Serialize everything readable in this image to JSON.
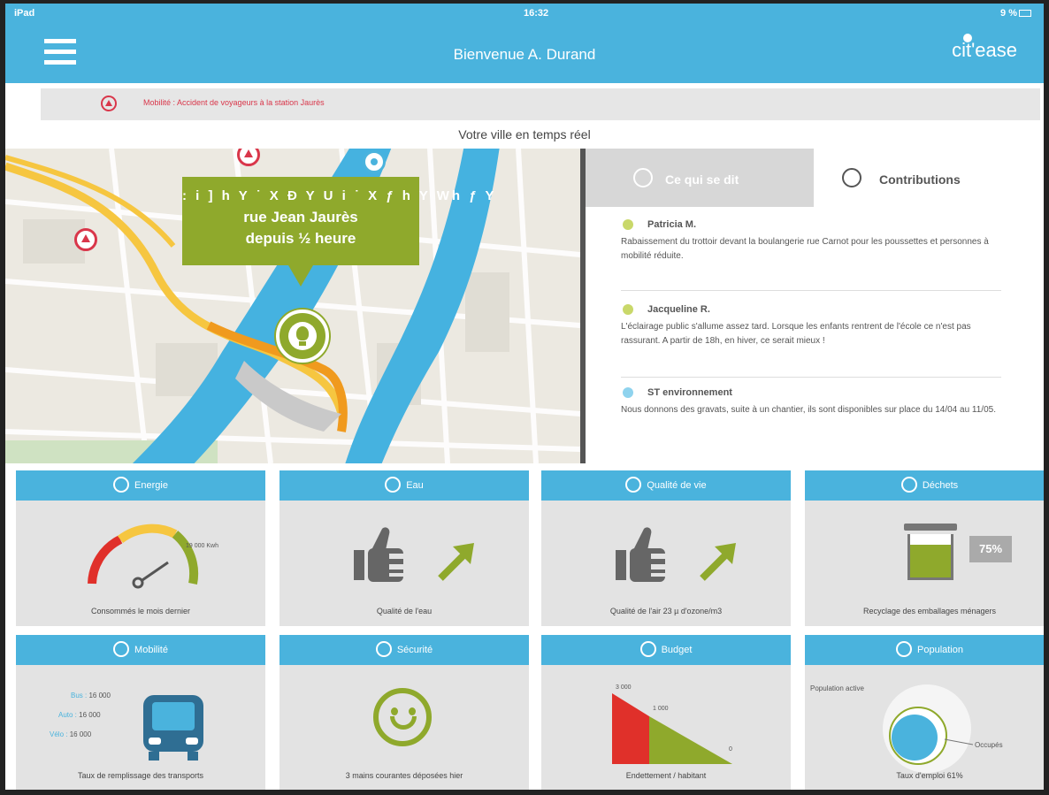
{
  "status_bar": {
    "carrier": "iPad",
    "time": "16:32",
    "battery": "9 %"
  },
  "header": {
    "title": "Bienvenue A. Durand",
    "logo": "cit'ease",
    "accent": "#4ab3dd"
  },
  "alert": {
    "text": "Mobilité : Accident de voyageurs à la station Jaurès",
    "color": "#d9364a"
  },
  "section_title": "Votre ville en temps réel",
  "map": {
    "tooltip": {
      "line1": ": i ] h Y ˙ X Ð Y U i ˙ X ƒ h Y Wh ƒ Y",
      "line2": "rue Jean Jaurès",
      "line3": "depuis ½ heure"
    },
    "pin_icon": "lightbulb-icon",
    "highlight": "#8fa92c"
  },
  "panel": {
    "tabs": [
      {
        "label": "Ce qui se dit",
        "icon": "twitter-icon"
      },
      {
        "label": "Contributions",
        "icon": "smiley-icon"
      }
    ],
    "contributions": [
      {
        "name": "Patricia M.",
        "text": "Rabaissement du trottoir devant la boulangerie rue Carnot pour les poussettes et personnes à mobilité réduite."
      },
      {
        "name": "Jacqueline R.",
        "text": "L'éclairage public s'allume assez tard. Lorsque les enfants rentrent de l'école ce n'est pas rassurant. A partir de 18h, en hiver, ce serait mieux !"
      },
      {
        "name": "ST environnement",
        "text": "Nous donnons des gravats, suite à un chantier, ils sont disponibles sur place du 14/04 au 11/05."
      }
    ]
  },
  "tiles": {
    "energie": {
      "title": "Energie",
      "icon": "energy-icon",
      "gauge_label": "19 000 Kwh",
      "footer": "Consommés le mois dernier"
    },
    "eau": {
      "title": "Eau",
      "icon": "water-icon",
      "footer": "Qualité de l'eau"
    },
    "qualite": {
      "title": "Qualité de vie",
      "icon": "leaf-icon",
      "footer": "Qualité de l'air 23 µ d'ozone/m3"
    },
    "dechets": {
      "title": "Déchets",
      "icon": "trash-icon",
      "percent": "75%",
      "fill": 0.75,
      "footer": "Recyclage des emballages ménagers"
    },
    "mobilite": {
      "title": "Mobilité",
      "icon": "bus-icon",
      "rows": [
        {
          "label": "Bus :",
          "value": "16 000"
        },
        {
          "label": "Auto :",
          "value": "16 000"
        },
        {
          "label": "Vélo :",
          "value": "16 000"
        }
      ],
      "footer": "Taux de remplissage des transports"
    },
    "securite": {
      "title": "Sécurité",
      "icon": "shield-icon",
      "footer": "3 mains courantes déposées hier"
    },
    "budget": {
      "title": "Budget",
      "icon": "budget-icon",
      "label_high": "3 000",
      "label_mid": "1 000",
      "label_low": "0",
      "footer": "Endettement / habitant"
    },
    "population": {
      "title": "Population",
      "icon": "population-icon",
      "label_active": "Population active",
      "label_occupied": "Occupés",
      "footer": "Taux d'emploi 61%"
    }
  }
}
